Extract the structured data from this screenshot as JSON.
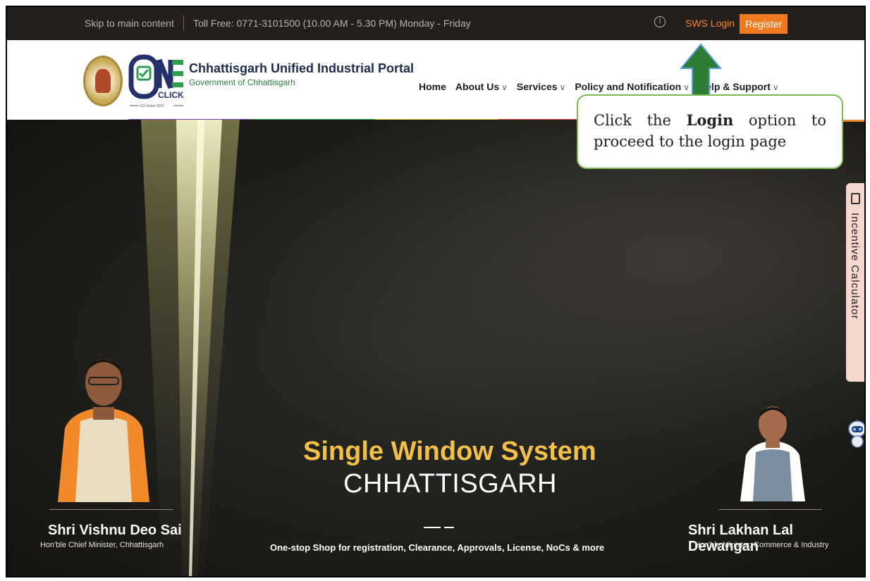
{
  "topbar": {
    "skip_link": "Skip to main content",
    "toll_free": "Toll Free: 0771-3101500 (10.00 AM - 5.30 PM) Monday - Friday",
    "accessibility_glyph": "i",
    "login_label": "SWS Login",
    "register_label": "Register"
  },
  "header": {
    "logo_text": "CLICK",
    "logo_tagline": "CG Vision 2047",
    "title": "Chhattisgarh Unified Industrial Portal",
    "subtitle": "Government of Chhattisgarh",
    "nav": [
      {
        "label": "Home",
        "has_dropdown": false
      },
      {
        "label": "About Us",
        "has_dropdown": true
      },
      {
        "label": "Services",
        "has_dropdown": true
      },
      {
        "label": "Policy and Notification",
        "has_dropdown": true
      },
      {
        "label": "Help & Support",
        "has_dropdown": true
      }
    ],
    "colorbar": [
      "#7a3fb3",
      "#2e9e4f",
      "#f2c230",
      "#e2443a"
    ]
  },
  "hero": {
    "title": "Single Window System",
    "state": "CHHATTISGARH",
    "tagline": "One-stop Shop for registration, Clearance, Approvals, License, NoCs & more",
    "left_person": {
      "name": "Shri Vishnu Deo Sai",
      "role": "Hon'ble Chief Minister, Chhattisgarh"
    },
    "right_person": {
      "name": "Shri Lakhan Lal Dewangan",
      "role": "Hon'ble Minister, Commerce & Industry"
    }
  },
  "sidetab": {
    "label": "Incentive Calculator",
    "icon": "calculator-icon"
  },
  "annotation": {
    "prefix": "Click the ",
    "bold": "Login",
    "suffix": " option to proceed to the login page"
  },
  "colors": {
    "topbar_bg": "#241f1b",
    "accent_orange": "#f07a22",
    "hero_title": "#f2c04a",
    "callout_border": "#7dbb57",
    "arrow_fill": "#2e7d32"
  }
}
